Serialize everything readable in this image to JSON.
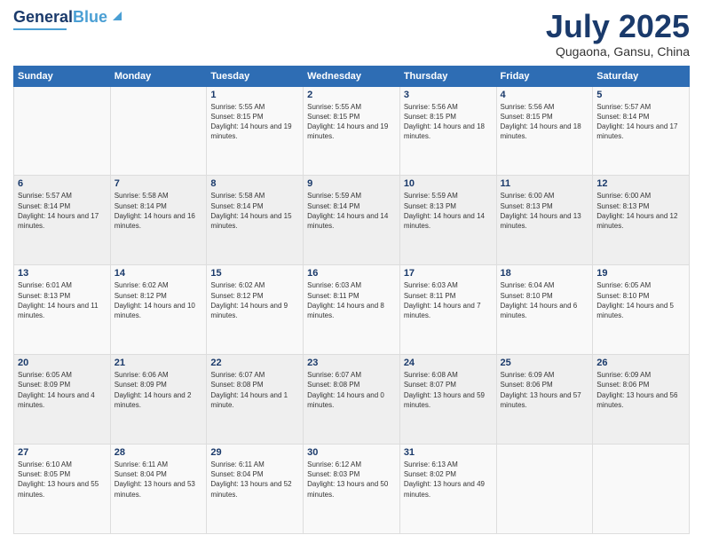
{
  "header": {
    "logo_line1": "General",
    "logo_line2": "Blue",
    "month_year": "July 2025",
    "location": "Qugaona, Gansu, China"
  },
  "weekdays": [
    "Sunday",
    "Monday",
    "Tuesday",
    "Wednesday",
    "Thursday",
    "Friday",
    "Saturday"
  ],
  "weeks": [
    [
      {
        "day": "",
        "info": ""
      },
      {
        "day": "",
        "info": ""
      },
      {
        "day": "1",
        "info": "Sunrise: 5:55 AM\nSunset: 8:15 PM\nDaylight: 14 hours and 19 minutes."
      },
      {
        "day": "2",
        "info": "Sunrise: 5:55 AM\nSunset: 8:15 PM\nDaylight: 14 hours and 19 minutes."
      },
      {
        "day": "3",
        "info": "Sunrise: 5:56 AM\nSunset: 8:15 PM\nDaylight: 14 hours and 18 minutes."
      },
      {
        "day": "4",
        "info": "Sunrise: 5:56 AM\nSunset: 8:15 PM\nDaylight: 14 hours and 18 minutes."
      },
      {
        "day": "5",
        "info": "Sunrise: 5:57 AM\nSunset: 8:14 PM\nDaylight: 14 hours and 17 minutes."
      }
    ],
    [
      {
        "day": "6",
        "info": "Sunrise: 5:57 AM\nSunset: 8:14 PM\nDaylight: 14 hours and 17 minutes."
      },
      {
        "day": "7",
        "info": "Sunrise: 5:58 AM\nSunset: 8:14 PM\nDaylight: 14 hours and 16 minutes."
      },
      {
        "day": "8",
        "info": "Sunrise: 5:58 AM\nSunset: 8:14 PM\nDaylight: 14 hours and 15 minutes."
      },
      {
        "day": "9",
        "info": "Sunrise: 5:59 AM\nSunset: 8:14 PM\nDaylight: 14 hours and 14 minutes."
      },
      {
        "day": "10",
        "info": "Sunrise: 5:59 AM\nSunset: 8:13 PM\nDaylight: 14 hours and 14 minutes."
      },
      {
        "day": "11",
        "info": "Sunrise: 6:00 AM\nSunset: 8:13 PM\nDaylight: 14 hours and 13 minutes."
      },
      {
        "day": "12",
        "info": "Sunrise: 6:00 AM\nSunset: 8:13 PM\nDaylight: 14 hours and 12 minutes."
      }
    ],
    [
      {
        "day": "13",
        "info": "Sunrise: 6:01 AM\nSunset: 8:13 PM\nDaylight: 14 hours and 11 minutes."
      },
      {
        "day": "14",
        "info": "Sunrise: 6:02 AM\nSunset: 8:12 PM\nDaylight: 14 hours and 10 minutes."
      },
      {
        "day": "15",
        "info": "Sunrise: 6:02 AM\nSunset: 8:12 PM\nDaylight: 14 hours and 9 minutes."
      },
      {
        "day": "16",
        "info": "Sunrise: 6:03 AM\nSunset: 8:11 PM\nDaylight: 14 hours and 8 minutes."
      },
      {
        "day": "17",
        "info": "Sunrise: 6:03 AM\nSunset: 8:11 PM\nDaylight: 14 hours and 7 minutes."
      },
      {
        "day": "18",
        "info": "Sunrise: 6:04 AM\nSunset: 8:10 PM\nDaylight: 14 hours and 6 minutes."
      },
      {
        "day": "19",
        "info": "Sunrise: 6:05 AM\nSunset: 8:10 PM\nDaylight: 14 hours and 5 minutes."
      }
    ],
    [
      {
        "day": "20",
        "info": "Sunrise: 6:05 AM\nSunset: 8:09 PM\nDaylight: 14 hours and 4 minutes."
      },
      {
        "day": "21",
        "info": "Sunrise: 6:06 AM\nSunset: 8:09 PM\nDaylight: 14 hours and 2 minutes."
      },
      {
        "day": "22",
        "info": "Sunrise: 6:07 AM\nSunset: 8:08 PM\nDaylight: 14 hours and 1 minute."
      },
      {
        "day": "23",
        "info": "Sunrise: 6:07 AM\nSunset: 8:08 PM\nDaylight: 14 hours and 0 minutes."
      },
      {
        "day": "24",
        "info": "Sunrise: 6:08 AM\nSunset: 8:07 PM\nDaylight: 13 hours and 59 minutes."
      },
      {
        "day": "25",
        "info": "Sunrise: 6:09 AM\nSunset: 8:06 PM\nDaylight: 13 hours and 57 minutes."
      },
      {
        "day": "26",
        "info": "Sunrise: 6:09 AM\nSunset: 8:06 PM\nDaylight: 13 hours and 56 minutes."
      }
    ],
    [
      {
        "day": "27",
        "info": "Sunrise: 6:10 AM\nSunset: 8:05 PM\nDaylight: 13 hours and 55 minutes."
      },
      {
        "day": "28",
        "info": "Sunrise: 6:11 AM\nSunset: 8:04 PM\nDaylight: 13 hours and 53 minutes."
      },
      {
        "day": "29",
        "info": "Sunrise: 6:11 AM\nSunset: 8:04 PM\nDaylight: 13 hours and 52 minutes."
      },
      {
        "day": "30",
        "info": "Sunrise: 6:12 AM\nSunset: 8:03 PM\nDaylight: 13 hours and 50 minutes."
      },
      {
        "day": "31",
        "info": "Sunrise: 6:13 AM\nSunset: 8:02 PM\nDaylight: 13 hours and 49 minutes."
      },
      {
        "day": "",
        "info": ""
      },
      {
        "day": "",
        "info": ""
      }
    ]
  ]
}
